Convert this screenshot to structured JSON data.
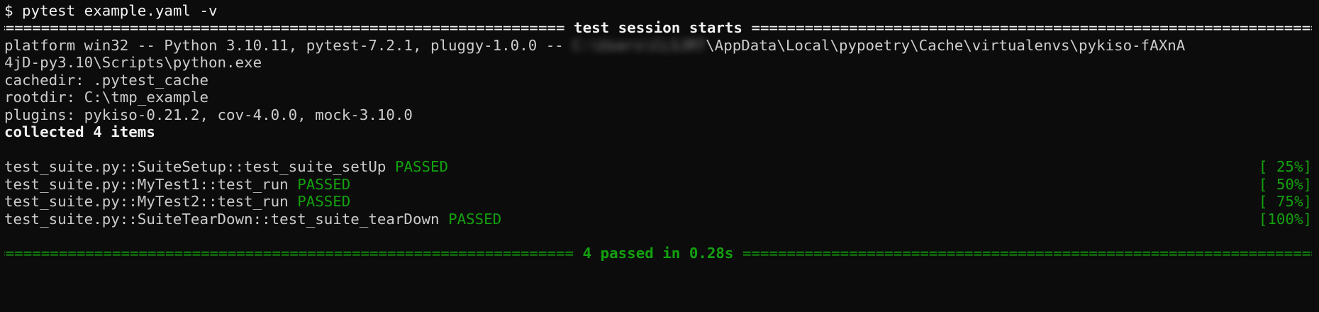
{
  "prompt": "$ pytest example.yaml -v",
  "session_header": {
    "title": " test session starts ",
    "fill": "=========================================================================================================================="
  },
  "platform": {
    "prefix": "platform win32 -- Python 3.10.11, pytest-7.2.1, pluggy-1.0.0 -- ",
    "redacted": "C:\\Users\\CLSJRT",
    "suffix": "\\AppData\\Local\\pypoetry\\Cache\\virtualenvs\\pykiso-fAXnA",
    "continuation": "4jD-py3.10\\Scripts\\python.exe"
  },
  "cachedir": "cachedir: .pytest_cache",
  "rootdir": "rootdir: C:\\tmp_example",
  "plugins": "plugins: pykiso-0.21.2, cov-4.0.0, mock-3.10.0",
  "collected": "collected 4 items",
  "tests": [
    {
      "name": "test_suite.py::SuiteSetup::test_suite_setUp",
      "status": "PASSED",
      "progress": "[ 25%]"
    },
    {
      "name": "test_suite.py::MyTest1::test_run",
      "status": "PASSED",
      "progress": "[ 50%]"
    },
    {
      "name": "test_suite.py::MyTest2::test_run",
      "status": "PASSED",
      "progress": "[ 75%]"
    },
    {
      "name": "test_suite.py::SuiteTearDown::test_suite_tearDown",
      "status": "PASSED",
      "progress": "[100%]"
    }
  ],
  "summary": {
    "title": " 4 passed in 0.28s ",
    "fill": "=========================================================================================================================="
  },
  "colors": {
    "background": "#0c0c0c",
    "text": "#cccccc",
    "pass": "#13a10e"
  }
}
